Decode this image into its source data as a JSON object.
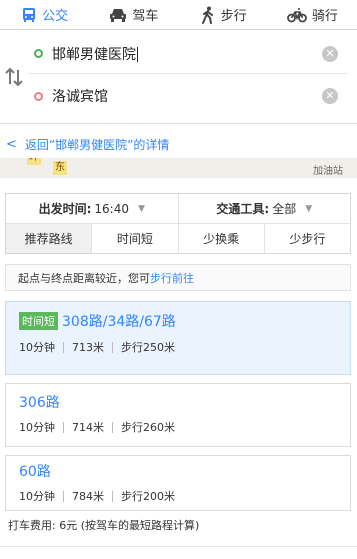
{
  "modes": [
    {
      "label": "公交",
      "icon": "bus-icon",
      "active": true
    },
    {
      "label": "驾车",
      "icon": "car-icon",
      "active": false
    },
    {
      "label": "步行",
      "icon": "walk-icon",
      "active": false
    },
    {
      "label": "骑行",
      "icon": "bike-icon",
      "active": false
    }
  ],
  "inputs": {
    "start": "邯郸男健医院",
    "end": "洛诚宾馆"
  },
  "back_link": "返回“邯郸男健医院”的详情",
  "map_strip": {
    "tags": [
      "环",
      "东"
    ],
    "poi": "加油站"
  },
  "filter": {
    "depart_label": "出发时间:",
    "depart_value": "16:40",
    "transport_label": "交通工具:",
    "transport_value": "全部",
    "tabs": [
      "推荐路线",
      "时间短",
      "少换乘",
      "少步行"
    ],
    "selected_tab": 0
  },
  "note": {
    "text": "起点与终点距离较近，您可",
    "link": "步行前往"
  },
  "routes": [
    {
      "badge": "时间短",
      "name": "308路/34路/67路",
      "time": "10分钟",
      "distance": "713米",
      "walk": "步行250米"
    },
    {
      "badge": "",
      "name": "306路",
      "time": "10分钟",
      "distance": "714米",
      "walk": "步行260米"
    },
    {
      "badge": "",
      "name": "60路",
      "time": "10分钟",
      "distance": "784米",
      "walk": "步行200米"
    }
  ],
  "fare": "打车费用: 6元 (按驾车的最短路程计算)",
  "colors": {
    "accent": "#3385ff",
    "badge": "#5cb85c",
    "selected_bg": "#ebf3ff"
  }
}
